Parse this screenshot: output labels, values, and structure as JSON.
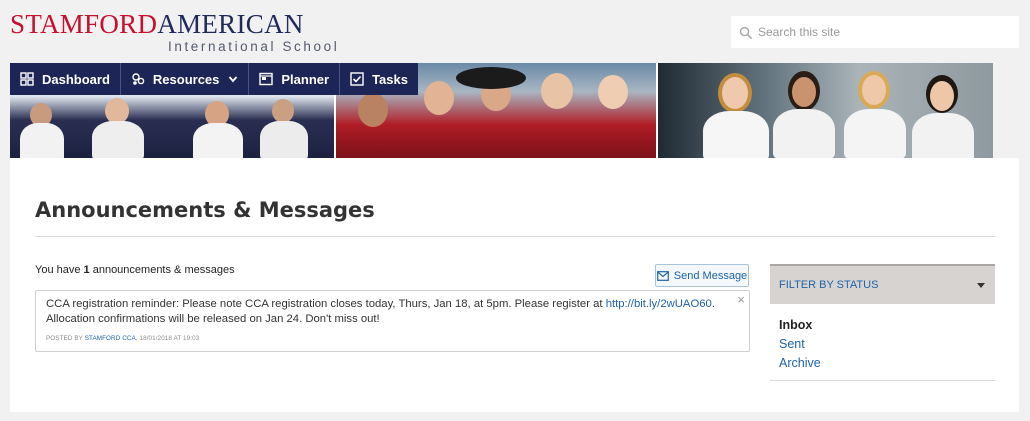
{
  "logo": {
    "part1": "STAMFORD",
    "part2": "AMERICAN",
    "sub": "International School"
  },
  "search": {
    "placeholder": "Search this site"
  },
  "nav": {
    "items": [
      {
        "label": "Dashboard",
        "icon": "dashboard-grid-icon"
      },
      {
        "label": "Resources",
        "icon": "resources-icon",
        "has_dropdown": true
      },
      {
        "label": "Planner",
        "icon": "planner-icon"
      },
      {
        "label": "Tasks",
        "icon": "tasks-checkbox-icon"
      }
    ]
  },
  "page": {
    "title": "Announcements & Messages"
  },
  "summary": {
    "prefix": "You have ",
    "count": "1",
    "suffix": " announcements & messages"
  },
  "send_button": {
    "label": "Send Message",
    "icon": "envelope-icon"
  },
  "message": {
    "text_before": "CCA registration reminder: Please note CCA registration closes today, Thurs, Jan 18, at 5pm. Please register at ",
    "link": "http://bit.ly/2wUAO60",
    "text_after": ". Allocation confirmations will be released on Jan 24. Don't miss out!",
    "close": "×",
    "meta_prefix": "POSTED BY ",
    "author": "STAMFORD CCA",
    "meta_suffix": ", 18/01/2018 AT 19:03"
  },
  "filter": {
    "heading": "FILTER BY STATUS",
    "options": [
      {
        "label": "Inbox",
        "active": true
      },
      {
        "label": "Sent",
        "active": false
      },
      {
        "label": "Archive",
        "active": false
      }
    ]
  },
  "colors": {
    "brand_red": "#c8102e",
    "brand_navy": "#1d2557",
    "link": "#1d63a8",
    "filter_bg": "#d7d3d1"
  }
}
